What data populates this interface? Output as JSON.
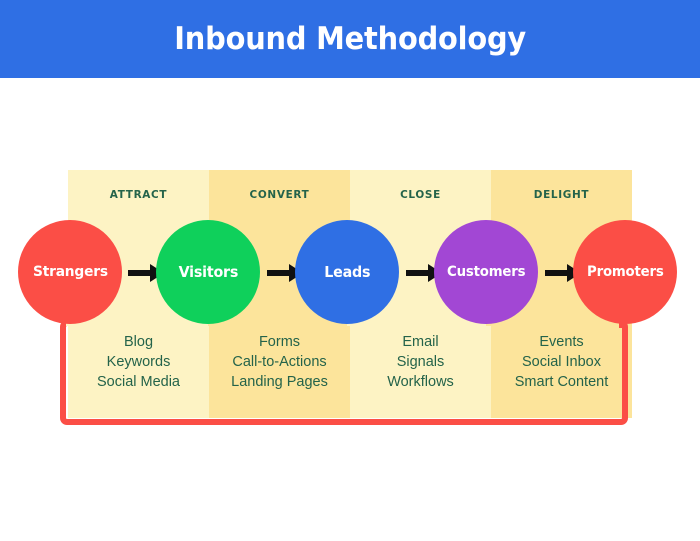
{
  "header": {
    "title": "Inbound Methodology",
    "background_color": "#2f6fe4",
    "text_color": "#ffffff"
  },
  "diagram": {
    "type": "funnel-process",
    "band_colors": {
      "light": "#fdf3c4",
      "dark": "#fce49b"
    },
    "outline_color": "#fb4e46",
    "label_text_color": "#24634a",
    "stages": [
      {
        "label": "ATTRACT",
        "shade": "light",
        "items": [
          "Blog",
          "Keywords",
          "Social Media"
        ]
      },
      {
        "label": "CONVERT",
        "shade": "dark",
        "items": [
          "Forms",
          "Call-to-Actions",
          "Landing Pages"
        ]
      },
      {
        "label": "CLOSE",
        "shade": "light",
        "items": [
          "Email",
          "Signals",
          "Workflows"
        ]
      },
      {
        "label": "DELIGHT",
        "shade": "dark",
        "items": [
          "Events",
          "Social Inbox",
          "Smart Content"
        ]
      }
    ],
    "nodes": [
      {
        "label": "Strangers",
        "color": "#fb4e46"
      },
      {
        "label": "Visitors",
        "color": "#0fd05b"
      },
      {
        "label": "Leads",
        "color": "#2f6fe4"
      },
      {
        "label": "Customers",
        "color": "#a247d4"
      },
      {
        "label": "Promoters",
        "color": "#fb4e46"
      }
    ],
    "connectors": [
      {
        "icon": "arrow-right-icon",
        "color": "#111111"
      },
      {
        "icon": "arrow-right-icon",
        "color": "#111111"
      },
      {
        "icon": "arrow-right-icon",
        "color": "#111111"
      },
      {
        "icon": "arrow-right-icon",
        "color": "#111111"
      }
    ]
  }
}
